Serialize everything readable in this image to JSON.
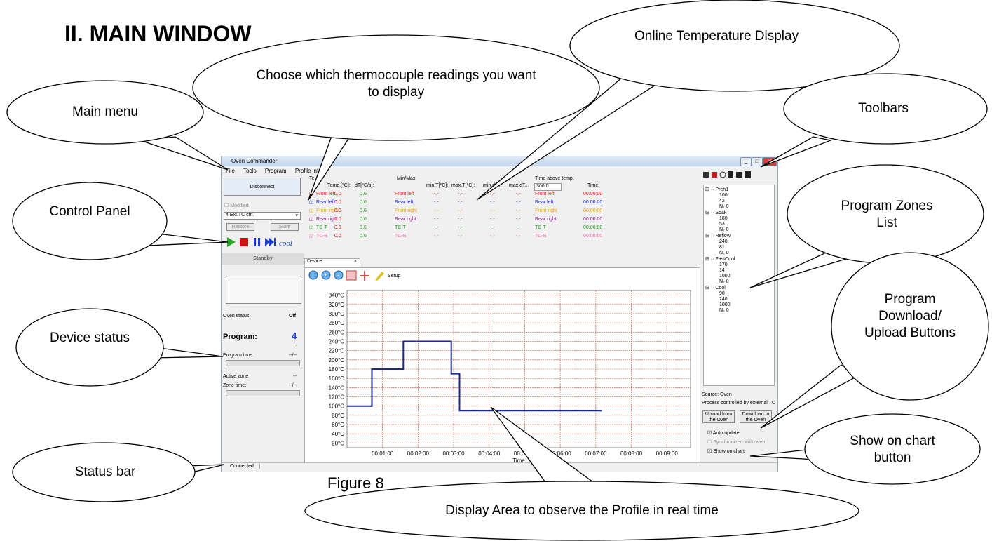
{
  "heading": "II. MAIN WINDOW",
  "figure_caption": "Figure 8",
  "callouts": {
    "main_menu": "Main menu",
    "choose_thermocouple": "Choose which thermocouple readings you want to display",
    "online_temp": "Online Temperature Display",
    "toolbars": "Toolbars",
    "control_panel": "Control Panel",
    "program_zones": "Program Zones List",
    "device_status": "Device status",
    "program_download": "Program Download/ Upload Buttons",
    "show_on_chart": "Show on chart button",
    "status_bar": "Status bar",
    "display_area": "Display Area to observe the Profile in real time"
  },
  "window": {
    "title": "Oven Commander",
    "menu": [
      "File",
      "Tools",
      "Program",
      "Profile info"
    ],
    "left": {
      "disconnect": "Disconnect",
      "modified": "Modified",
      "dropdown": "4 Ext.TC ctrl.",
      "restore": "Restore",
      "store": "Store",
      "standby": "Standby",
      "oven_status_label": "Oven status:",
      "oven_status_value": "Off",
      "program_label": "Program:",
      "program_value": "4",
      "dash1": "--",
      "program_time_label": "Program time:",
      "program_time_value": "--/--",
      "active_zone_label": "Active zone",
      "active_zone_value": "--",
      "zone_time_label": "Zone time:",
      "zone_time_value": "--/--"
    },
    "table": {
      "group_temp": "Te",
      "group_minmax": "Min/Max",
      "group_time": "Time above temp.",
      "threshold": "300.0",
      "headers": [
        "Temp.[°C]:",
        "dT[°C/s]:",
        "min.T[°C]:",
        "max.T[°C]:",
        "min.dT...",
        "max.dT...",
        "Time:"
      ],
      "rows": [
        {
          "name": "Front left",
          "temp": "0.0",
          "dt": "0.0",
          "min": "-.-",
          "max": "-.-",
          "mindt": "-.-",
          "maxdt": "-.-",
          "time": "00:00:00",
          "color": "#e02020"
        },
        {
          "name": "Rear left",
          "temp": "0.0",
          "dt": "0.0",
          "min": "-.-",
          "max": "-.-",
          "mindt": "-.-",
          "maxdt": "-.-",
          "time": "00:00:00",
          "color": "#2030d0"
        },
        {
          "name": "Front right",
          "temp": "0.0",
          "dt": "0.0",
          "min": "-.-",
          "max": "-.-",
          "mindt": "-.-",
          "maxdt": "-.-",
          "time": "00:00:00",
          "color": "#f0a020"
        },
        {
          "name": "Rear right",
          "temp": "0.0",
          "dt": "0.0",
          "min": "-.-",
          "max": "-.-",
          "mindt": "-.-",
          "maxdt": "-.-",
          "time": "00:00:00",
          "color": "#902090"
        },
        {
          "name": "TC-T",
          "temp": "0.0",
          "dt": "0.0",
          "min": "-.-",
          "max": "-.-",
          "mindt": "-.-",
          "maxdt": "-.-",
          "time": "00:00:00",
          "color": "#20a020"
        },
        {
          "name": "TC-B",
          "temp": "0.0",
          "dt": "0.0",
          "min": "-.-",
          "max": "-.-",
          "mindt": "-.-",
          "maxdt": "-.-",
          "time": "00:00:00",
          "color": "#f070b0"
        }
      ]
    },
    "tab_label": "Device",
    "setup_label": "Setup",
    "source": "Source: Oven",
    "process": "Process controlled by external TC",
    "upload_btn": "Upload from the Oven",
    "download_btn": "Download to the Oven",
    "auto_update": "Auto update",
    "synchronized": "Synchronized with oven",
    "show_on_chart": "Show on chart",
    "status_connected": "Connected",
    "tree": [
      {
        "name": "Preh1",
        "values": [
          "100",
          "42",
          "N₂ 0"
        ]
      },
      {
        "name": "Soak",
        "values": [
          "180",
          "53",
          "N₂ 0"
        ]
      },
      {
        "name": "Reflow",
        "values": [
          "240",
          "81",
          "N₂ 0"
        ]
      },
      {
        "name": "FastCool",
        "values": [
          "170",
          "14",
          "1000",
          "N₂ 0"
        ]
      },
      {
        "name": "Cool",
        "values": [
          "90",
          "240",
          "1000",
          "N₂ 0"
        ]
      }
    ],
    "time_axis_label": "Time",
    "colors": {
      "accent": "#1a2a8a",
      "grid": "#c06040"
    }
  },
  "chart_data": {
    "type": "line",
    "x_unit": "seconds",
    "y_ticks": [
      "340°C",
      "320°C",
      "300°C",
      "280°C",
      "260°C",
      "240°C",
      "220°C",
      "200°C",
      "180°C",
      "160°C",
      "140°C",
      "120°C",
      "100°C",
      "80°C",
      "60°C",
      "40°C",
      "20°C"
    ],
    "x_ticks": [
      "00:01:00",
      "00:02:00",
      "00:03:00",
      "00:04:00",
      "00:05:00",
      "00:06:00",
      "00:07:00",
      "00:08:00",
      "00:09:00"
    ],
    "ylim": [
      10,
      350
    ],
    "xlim": [
      0,
      580
    ],
    "series": [
      {
        "points": [
          [
            0,
            100
          ],
          [
            42,
            100
          ],
          [
            42,
            180
          ],
          [
            95,
            180
          ],
          [
            95,
            240
          ],
          [
            176,
            240
          ],
          [
            176,
            170
          ],
          [
            190,
            170
          ],
          [
            190,
            90
          ],
          [
            430,
            90
          ]
        ]
      }
    ]
  }
}
